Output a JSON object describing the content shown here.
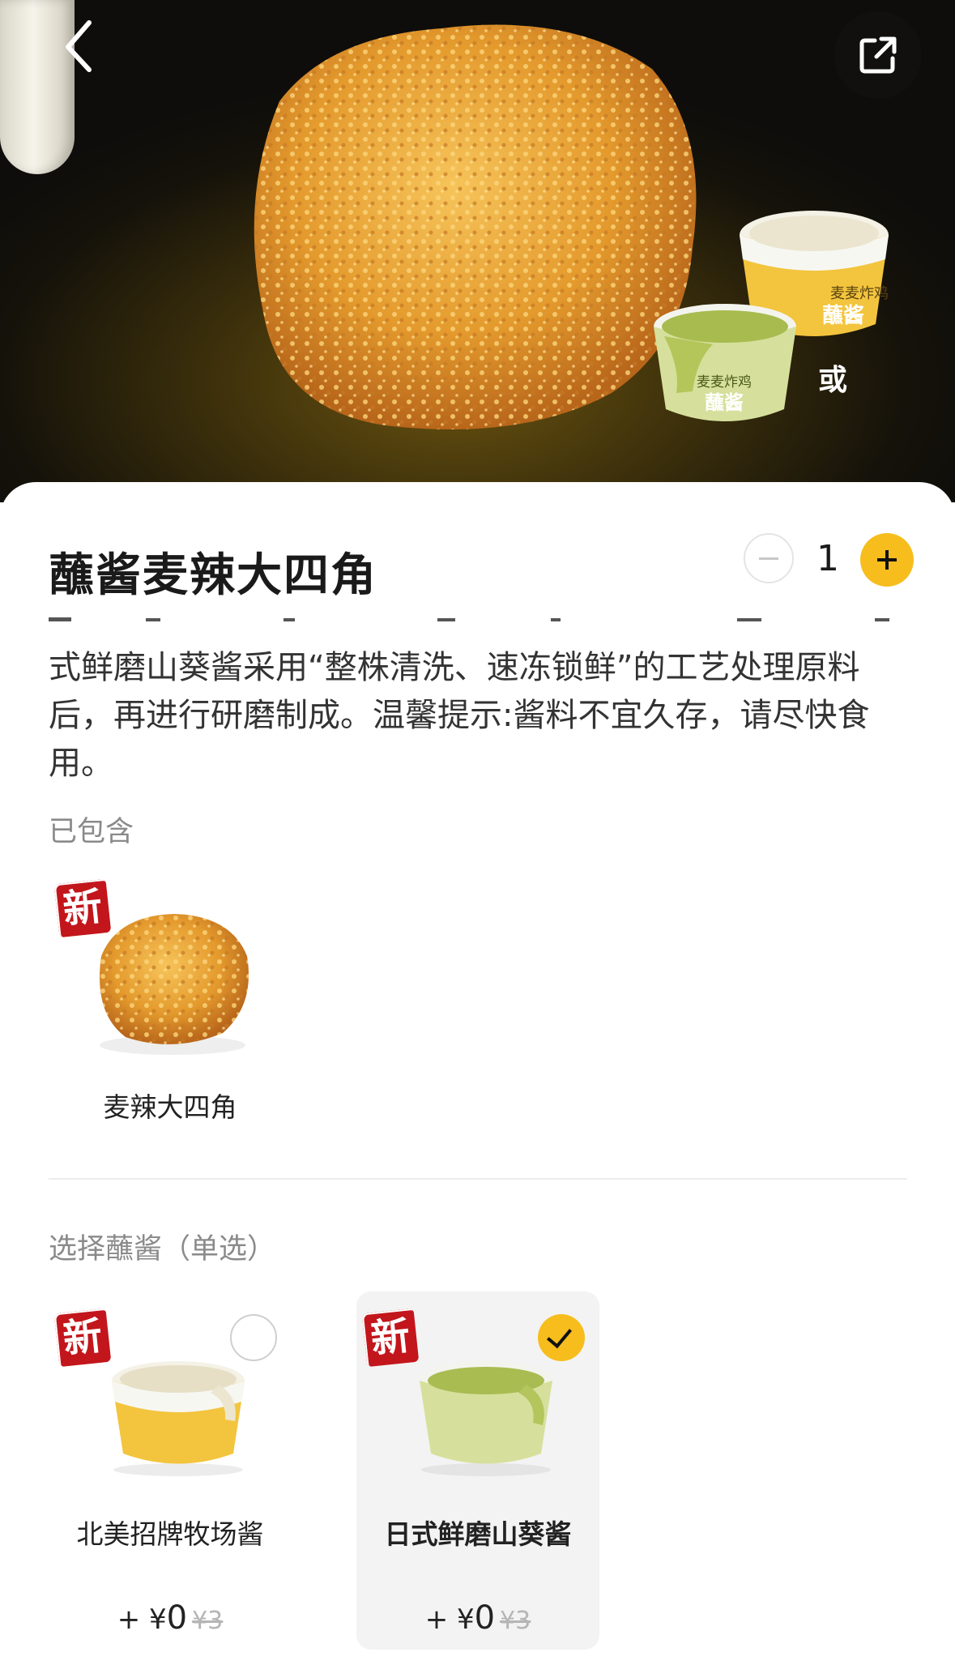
{
  "hero": {
    "or_text": "或",
    "cup_labels": [
      "麦麦炸鸡",
      "蘸酱"
    ]
  },
  "product": {
    "title": "蘸酱麦辣大四角",
    "quantity": "1",
    "description": "式鲜磨山葵酱采用“整株清洗、速冻锁鲜”的工艺处理原料后，再进行研磨制成。温馨提示:酱料不宜久存，请尽快食用。"
  },
  "included": {
    "label": "已包含",
    "items": [
      {
        "badge": "新",
        "name": "麦辣大四角"
      }
    ]
  },
  "sauce_select": {
    "label": "选择蘸酱（单选）",
    "options": [
      {
        "badge": "新",
        "name": "北美招牌牧场酱",
        "price_prefix": "+ ¥",
        "price": "0",
        "old_price": "¥3",
        "selected": false,
        "color": "#f5c53a"
      },
      {
        "badge": "新",
        "name": "日式鲜磨山葵酱",
        "price_prefix": "+ ¥",
        "price": "0",
        "old_price": "¥3",
        "selected": true,
        "color": "#b9cc6a"
      }
    ]
  },
  "colors": {
    "accent": "#f6bd1d",
    "badge_red": "#c2161c"
  }
}
